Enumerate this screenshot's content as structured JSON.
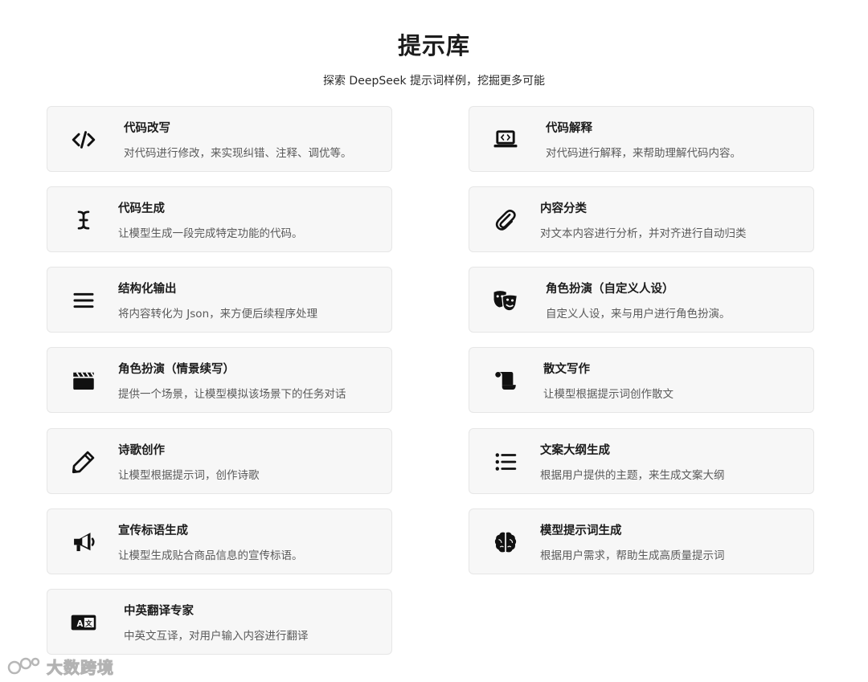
{
  "header": {
    "title": "提示库",
    "subtitle": "探索 DeepSeek 提示词样例，挖掘更多可能"
  },
  "cards": [
    {
      "title": "代码改写",
      "desc": "对代码进行修改，来实现纠错、注释、调优等。",
      "icon": "code-icon"
    },
    {
      "title": "代码解释",
      "desc": "对代码进行解释，来帮助理解代码内容。",
      "icon": "laptop-code-icon"
    },
    {
      "title": "代码生成",
      "desc": "让模型生成一段完成特定功能的代码。",
      "icon": "text-cursor-icon"
    },
    {
      "title": "内容分类",
      "desc": "对文本内容进行分析，并对齐进行自动归类",
      "icon": "paperclip-icon"
    },
    {
      "title": "结构化输出",
      "desc": "将内容转化为 Json，来方便后续程序处理",
      "icon": "menu-icon"
    },
    {
      "title": "角色扮演（自定义人设）",
      "desc": "自定义人设，来与用户进行角色扮演。",
      "icon": "theater-masks-icon"
    },
    {
      "title": "角色扮演（情景续写）",
      "desc": "提供一个场景，让模型模拟该场景下的任务对话",
      "icon": "clapperboard-icon"
    },
    {
      "title": "散文写作",
      "desc": "让模型根据提示词创作散文",
      "icon": "scroll-icon"
    },
    {
      "title": "诗歌创作",
      "desc": "让模型根据提示词，创作诗歌",
      "icon": "pencil-icon"
    },
    {
      "title": "文案大纲生成",
      "desc": "根据用户提供的主题，来生成文案大纲",
      "icon": "list-icon"
    },
    {
      "title": "宣传标语生成",
      "desc": "让模型生成贴合商品信息的宣传标语。",
      "icon": "megaphone-icon"
    },
    {
      "title": "模型提示词生成",
      "desc": "根据用户需求，帮助生成高质量提示词",
      "icon": "brain-icon"
    },
    {
      "title": "中英翻译专家",
      "desc": "中英文互译，对用户输入内容进行翻译",
      "icon": "language-icon"
    }
  ],
  "watermark": {
    "text": "大数跨境"
  }
}
